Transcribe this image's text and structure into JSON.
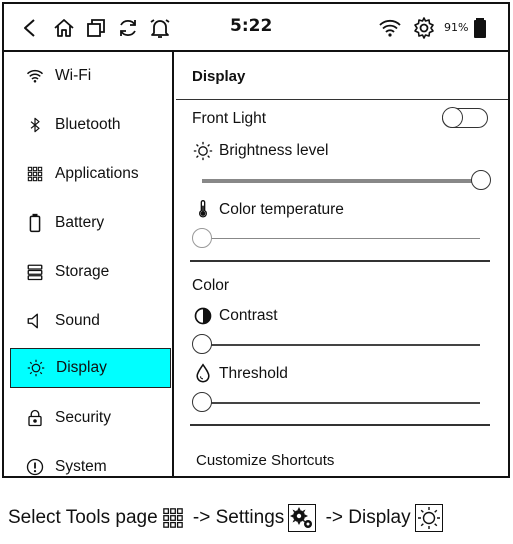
{
  "status_bar": {
    "time": "5:22",
    "battery_level": "91%",
    "icons": [
      "back-icon",
      "home-icon",
      "multitask-icon",
      "refresh-icon",
      "notification-bell-icon",
      "wifi-icon",
      "gear-icon",
      "battery-icon"
    ]
  },
  "sidebar": {
    "items": [
      {
        "label": "Wi-Fi",
        "icon": "wifi-icon"
      },
      {
        "label": "Bluetooth",
        "icon": "bluetooth-icon"
      },
      {
        "label": "Applications",
        "icon": "apps-grid-icon"
      },
      {
        "label": "Battery",
        "icon": "battery-icon"
      },
      {
        "label": "Storage",
        "icon": "storage-icon"
      },
      {
        "label": "Sound",
        "icon": "speaker-icon"
      },
      {
        "label": "Display",
        "icon": "sun-icon",
        "active": true
      },
      {
        "label": "Security",
        "icon": "lock-icon"
      },
      {
        "label": "System",
        "icon": "info-icon"
      }
    ],
    "active_color": "#00ffff"
  },
  "display": {
    "title": "Display",
    "front_light": {
      "label": "Front Light",
      "enabled": false
    },
    "brightness": {
      "label": "Brightness level",
      "value": 1.0
    },
    "color_temperature": {
      "label": "Color temperature",
      "value": 0.0
    },
    "color_section": {
      "label": "Color",
      "contrast": {
        "label": "Contrast",
        "value": 0.0
      },
      "threshold": {
        "label": "Threshold",
        "value": 0.0
      }
    },
    "customize_shortcuts": "Customize Shortcuts"
  },
  "caption": {
    "part1": "Select Tools page",
    "arrow1": " -> Settings",
    "arrow2": " -> Display"
  }
}
